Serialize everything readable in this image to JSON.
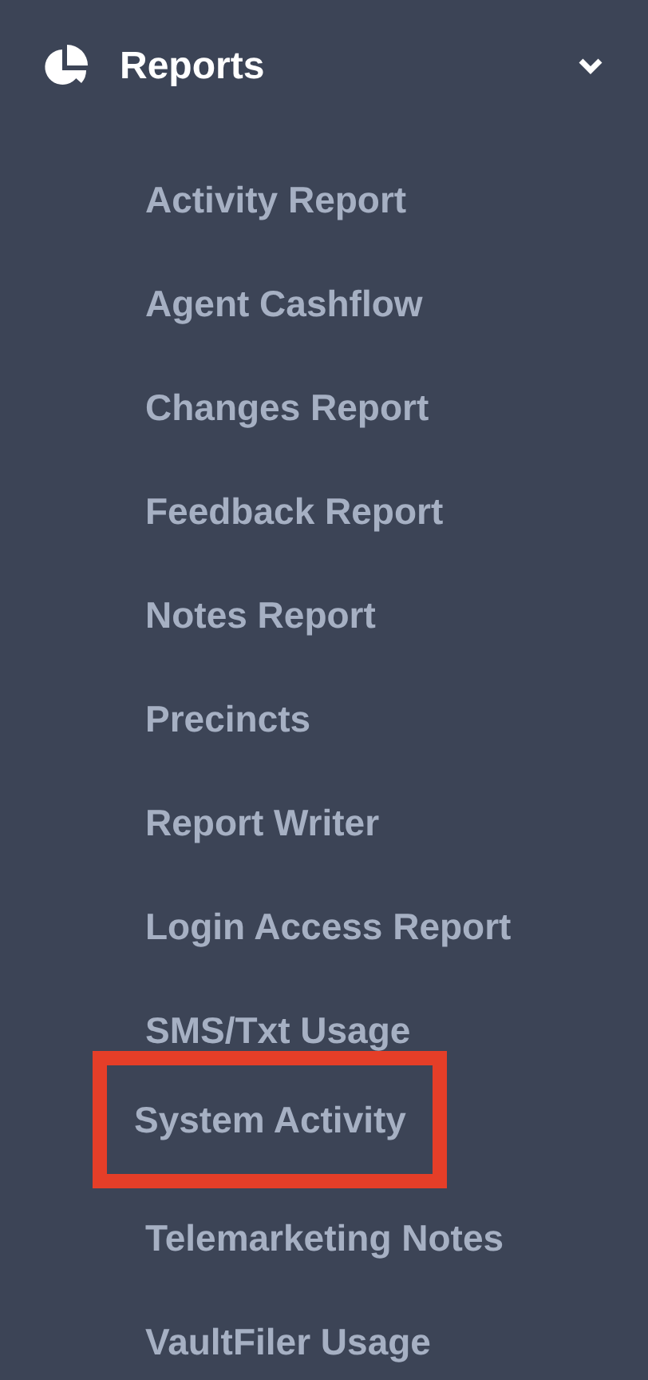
{
  "menu": {
    "title": "Reports",
    "expanded": true,
    "items": [
      {
        "label": "Activity Report",
        "highlighted": false
      },
      {
        "label": "Agent Cashflow",
        "highlighted": false
      },
      {
        "label": "Changes Report",
        "highlighted": false
      },
      {
        "label": "Feedback Report",
        "highlighted": false
      },
      {
        "label": "Notes Report",
        "highlighted": false
      },
      {
        "label": "Precincts",
        "highlighted": false
      },
      {
        "label": "Report Writer",
        "highlighted": false
      },
      {
        "label": "Login Access Report",
        "highlighted": false
      },
      {
        "label": "SMS/Txt Usage",
        "highlighted": false
      },
      {
        "label": "System Activity",
        "highlighted": true
      },
      {
        "label": "Telemarketing Notes",
        "highlighted": false
      },
      {
        "label": "VaultFiler Usage",
        "highlighted": false
      }
    ]
  }
}
